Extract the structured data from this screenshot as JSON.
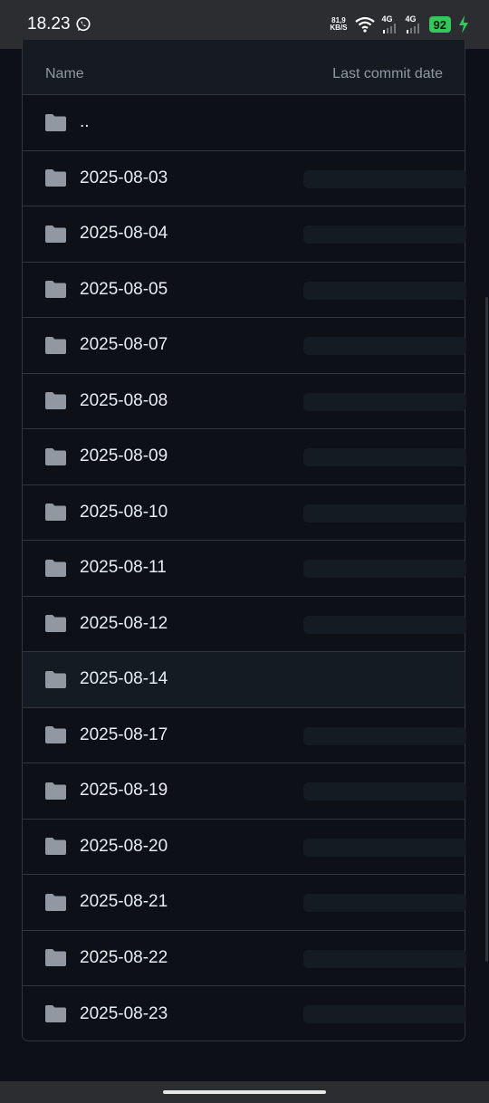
{
  "status_bar": {
    "time": "18.23",
    "net_speed_value": "81,9",
    "net_speed_unit": "KB/S",
    "sim1": "4G",
    "sim2": "4G",
    "battery": "92"
  },
  "table": {
    "headers": {
      "name": "Name",
      "last_commit_date": "Last commit date"
    },
    "parent_row": "..",
    "rows": [
      "2025-08-03",
      "2025-08-04",
      "2025-08-05",
      "2025-08-07",
      "2025-08-08",
      "2025-08-09",
      "2025-08-10",
      "2025-08-11",
      "2025-08-12",
      "2025-08-14",
      "2025-08-17",
      "2025-08-19",
      "2025-08-20",
      "2025-08-21",
      "2025-08-22",
      "2025-08-23"
    ]
  },
  "icons": {
    "folder": "folder-icon",
    "whatsapp": "whatsapp-icon",
    "wifi": "wifi-icon",
    "signal": "signal-icon",
    "charging": "charging-icon"
  },
  "colors": {
    "background": "#0d1117",
    "header_bg": "#161b22",
    "border": "#30363d",
    "folder": "#9198a1",
    "battery": "#34c759"
  }
}
